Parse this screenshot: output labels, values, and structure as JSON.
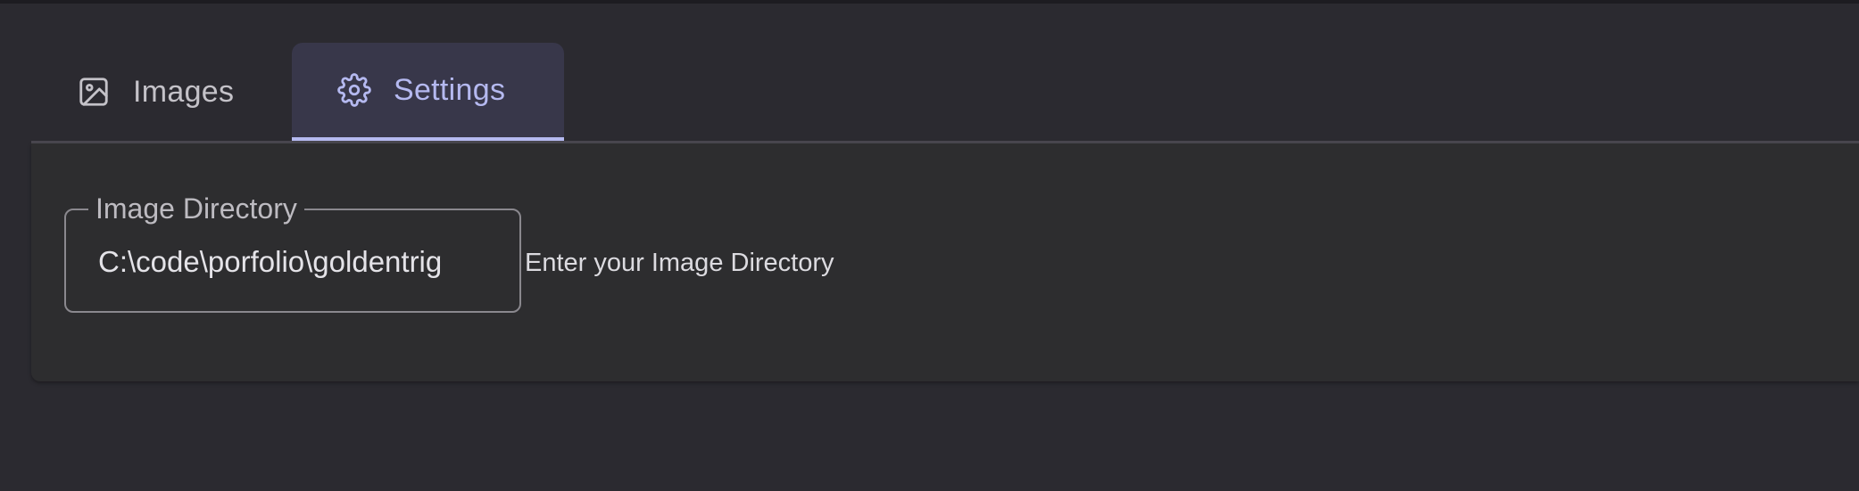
{
  "tabs": [
    {
      "label": "Images",
      "icon": "image-icon",
      "active": false
    },
    {
      "label": "Settings",
      "icon": "gear-icon",
      "active": true
    }
  ],
  "settings": {
    "image_directory": {
      "label": "Image Directory",
      "value": "C:\\code\\porfolio\\goldentrig",
      "helper": "Enter your Image Directory"
    }
  },
  "colors": {
    "background": "#2b2a30",
    "panel": "#2d2d2f",
    "active_tab_bg": "#38374a",
    "accent": "#b5b9f0",
    "inactive_text": "#c4c2c8"
  }
}
